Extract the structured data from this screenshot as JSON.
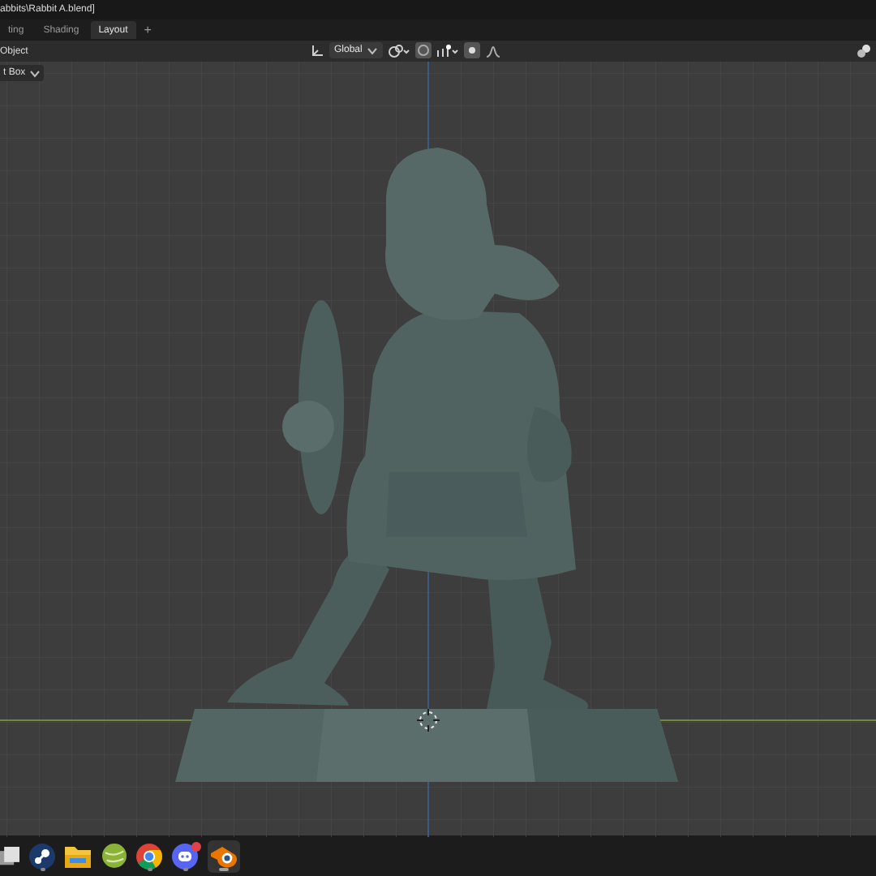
{
  "window": {
    "title": "abbits\\Rabbit A.blend]"
  },
  "workspace_tabs": [
    {
      "label": "ting",
      "selected": false
    },
    {
      "label": "Shading",
      "selected": false
    },
    {
      "label": "Layout",
      "selected": true
    }
  ],
  "add_tab": "+",
  "header": {
    "mode": "Object",
    "orientation": "Global"
  },
  "viewport": {
    "overlay_label": "t Box"
  },
  "taskbar": {
    "apps": [
      {
        "kind": "squares",
        "selected": false,
        "running": false,
        "notification": false
      },
      {
        "kind": "steam",
        "selected": false,
        "running": true,
        "notification": false
      },
      {
        "kind": "folder",
        "selected": false,
        "running": false,
        "notification": false
      },
      {
        "kind": "ball",
        "selected": false,
        "running": false,
        "notification": false
      },
      {
        "kind": "browser",
        "selected": false,
        "running": true,
        "notification": false
      },
      {
        "kind": "chat",
        "selected": false,
        "running": true,
        "notification": true
      },
      {
        "kind": "blender",
        "selected": true,
        "running": true,
        "notification": false
      }
    ]
  }
}
